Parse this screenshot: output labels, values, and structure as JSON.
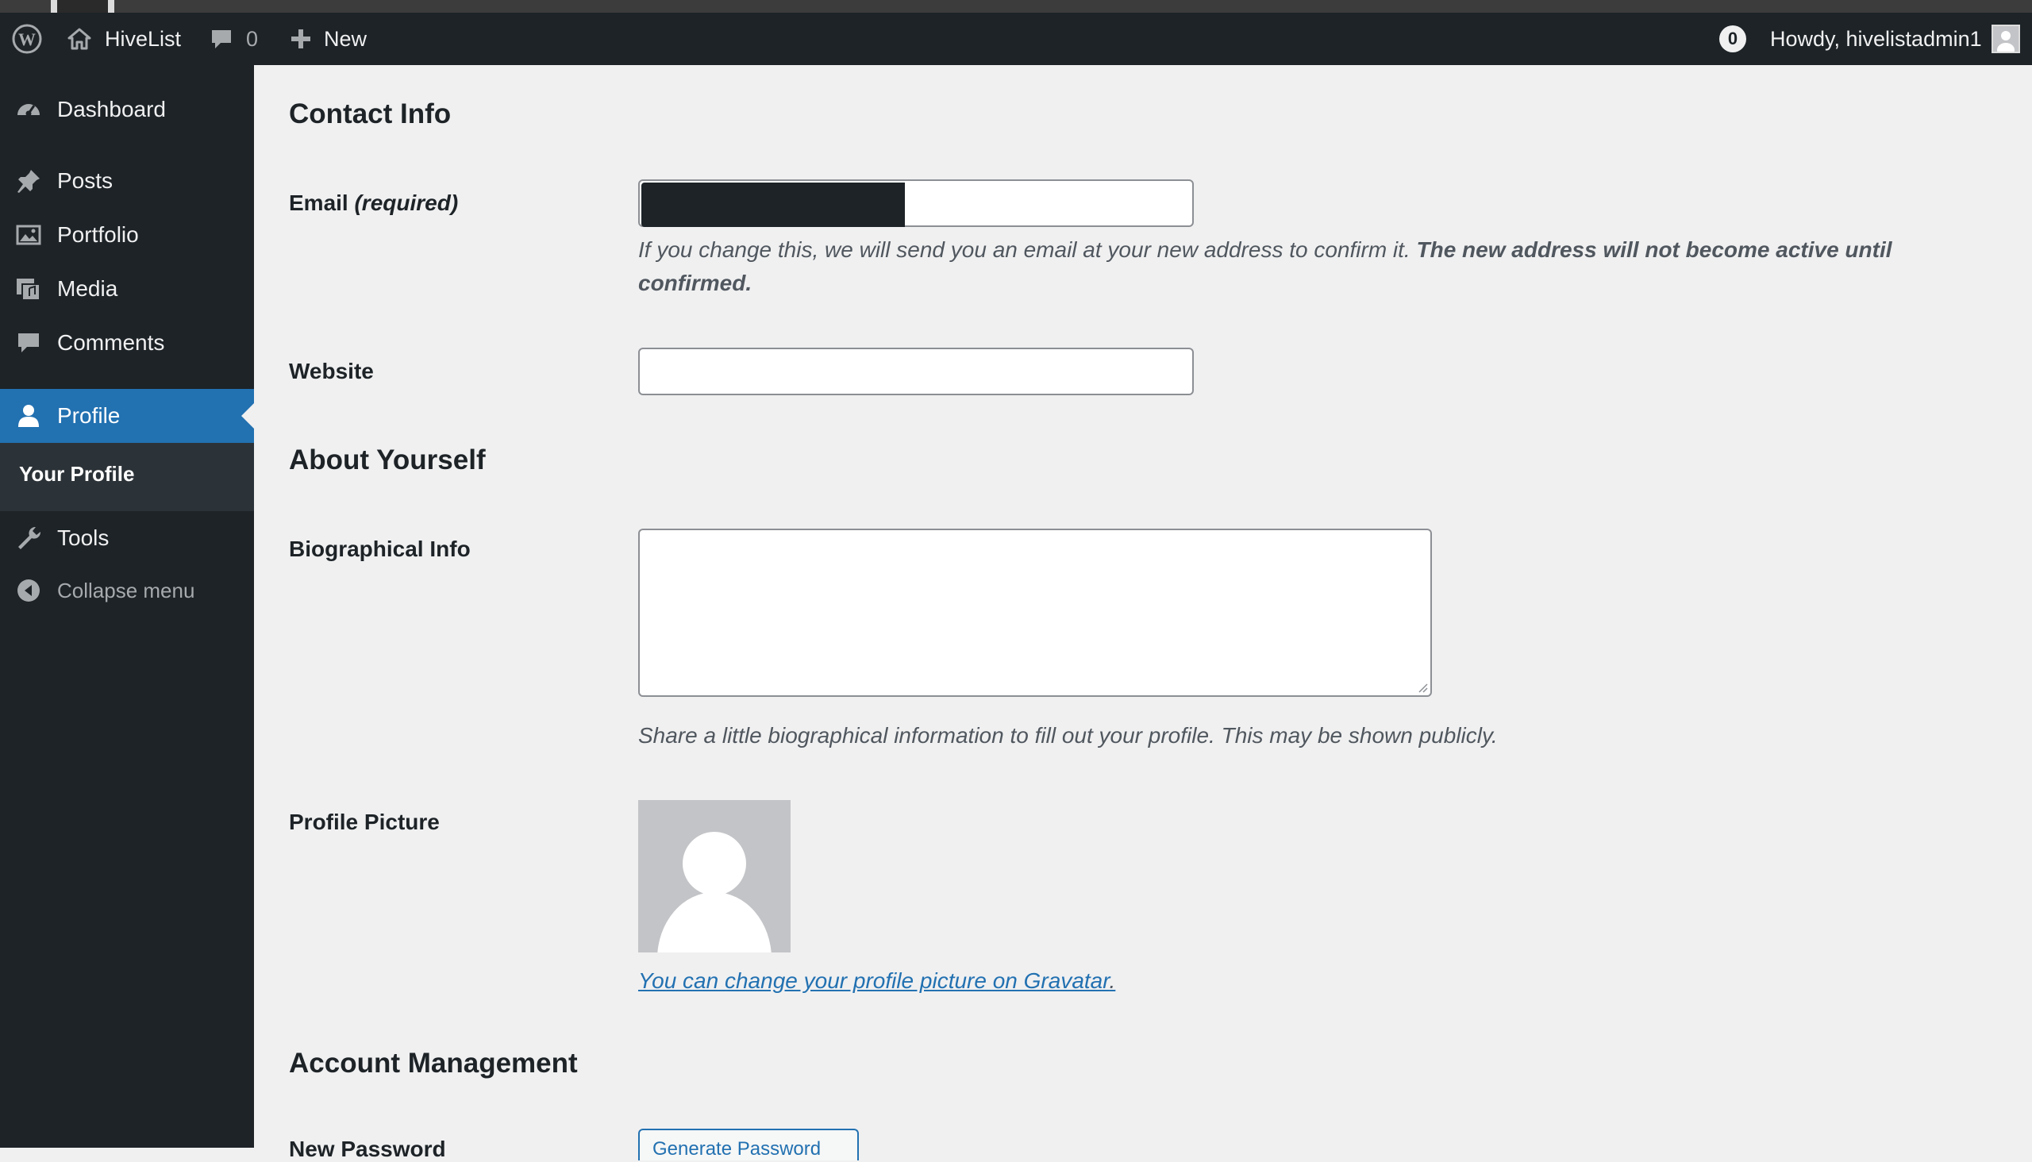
{
  "adminbar": {
    "wp_logo_icon": "wordpress-icon",
    "site_name": "HiveList",
    "comments_count": "0",
    "new_label": "New",
    "notifications_count": "0",
    "howdy_text": "Howdy, hivelistadmin1"
  },
  "sidebar": {
    "items": [
      {
        "label": "Dashboard",
        "icon": "dashboard-icon"
      },
      {
        "label": "Posts",
        "icon": "pin-icon"
      },
      {
        "label": "Portfolio",
        "icon": "image-icon"
      },
      {
        "label": "Media",
        "icon": "media-icon"
      },
      {
        "label": "Comments",
        "icon": "comment-icon"
      },
      {
        "label": "Profile",
        "icon": "user-icon"
      },
      {
        "label": "Tools",
        "icon": "wrench-icon"
      },
      {
        "label": "Collapse menu",
        "icon": "collapse-icon"
      }
    ],
    "submenu": {
      "label": "Your Profile"
    },
    "active_color": "#2271b1"
  },
  "content": {
    "contact_info_heading": "Contact Info",
    "email_label": "Email",
    "email_required": "(required)",
    "email_value": "",
    "email_desc_normal": "If you change this, we will send you an email at your new address to confirm it.",
    "email_desc_bold": "The new address will not become active until confirmed.",
    "website_label": "Website",
    "website_value": "",
    "about_heading": "About Yourself",
    "bio_label": "Biographical Info",
    "bio_value": "",
    "bio_desc": "Share a little biographical information to fill out your profile. This may be shown publicly.",
    "picture_label": "Profile Picture",
    "gravatar_link": "You can change your profile picture on Gravatar",
    "gravatar_suffix": ".",
    "account_heading": "Account Management",
    "new_password_label": "New Password",
    "generate_button": "Generate Password"
  }
}
